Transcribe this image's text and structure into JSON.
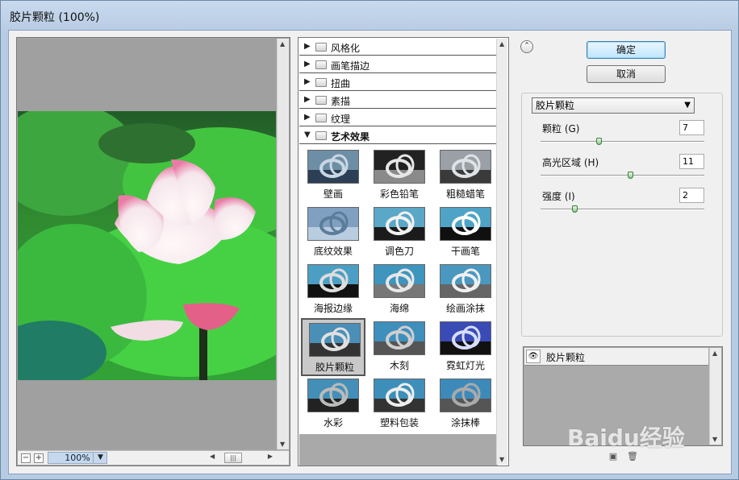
{
  "window": {
    "title": "胶片颗粒 (100%)"
  },
  "preview": {
    "zoom_minus": "−",
    "zoom_plus": "+",
    "zoom": "100%"
  },
  "filter_categories": [
    {
      "label": "风格化"
    },
    {
      "label": "画笔描边"
    },
    {
      "label": "扭曲"
    },
    {
      "label": "素描"
    },
    {
      "label": "纹理"
    },
    {
      "label": "艺术效果"
    }
  ],
  "filter_items": [
    {
      "label": "壁画",
      "icon": "fresco-thumb-icon"
    },
    {
      "label": "彩色铅笔",
      "icon": "colored-pencil-thumb-icon"
    },
    {
      "label": "粗糙蜡笔",
      "icon": "rough-pastels-thumb-icon"
    },
    {
      "label": "底纹效果",
      "icon": "underpainting-thumb-icon"
    },
    {
      "label": "调色刀",
      "icon": "palette-knife-thumb-icon"
    },
    {
      "label": "干画笔",
      "icon": "dry-brush-thumb-icon"
    },
    {
      "label": "海报边缘",
      "icon": "poster-edges-thumb-icon"
    },
    {
      "label": "海绵",
      "icon": "sponge-thumb-icon"
    },
    {
      "label": "绘画涂抹",
      "icon": "paint-daubs-thumb-icon"
    },
    {
      "label": "胶片颗粒",
      "icon": "film-grain-thumb-icon"
    },
    {
      "label": "木刻",
      "icon": "cutout-thumb-icon"
    },
    {
      "label": "霓虹灯光",
      "icon": "neon-glow-thumb-icon"
    },
    {
      "label": "水彩",
      "icon": "watercolor-thumb-icon"
    },
    {
      "label": "塑料包装",
      "icon": "plastic-wrap-thumb-icon"
    },
    {
      "label": "涂抹棒",
      "icon": "smudge-stick-thumb-icon"
    }
  ],
  "selected_filter": "胶片颗粒",
  "buttons": {
    "ok": "确定",
    "cancel": "取消"
  },
  "settings": {
    "filter_select": "胶片颗粒",
    "params": [
      {
        "label": "颗粒 (G)",
        "value": "7",
        "slider_fraction": 0.35
      },
      {
        "label": "高光区域 (H)",
        "value": "11",
        "slider_fraction": 0.55
      },
      {
        "label": "强度 (I)",
        "value": "2",
        "slider_fraction": 0.2
      }
    ]
  },
  "layers": {
    "name": "胶片颗粒"
  },
  "watermark": "Baidu经验",
  "colors": {
    "accent_button": "#bee6fd",
    "photo_green": "#39b83a",
    "petal_pink": "#e87aa4"
  }
}
